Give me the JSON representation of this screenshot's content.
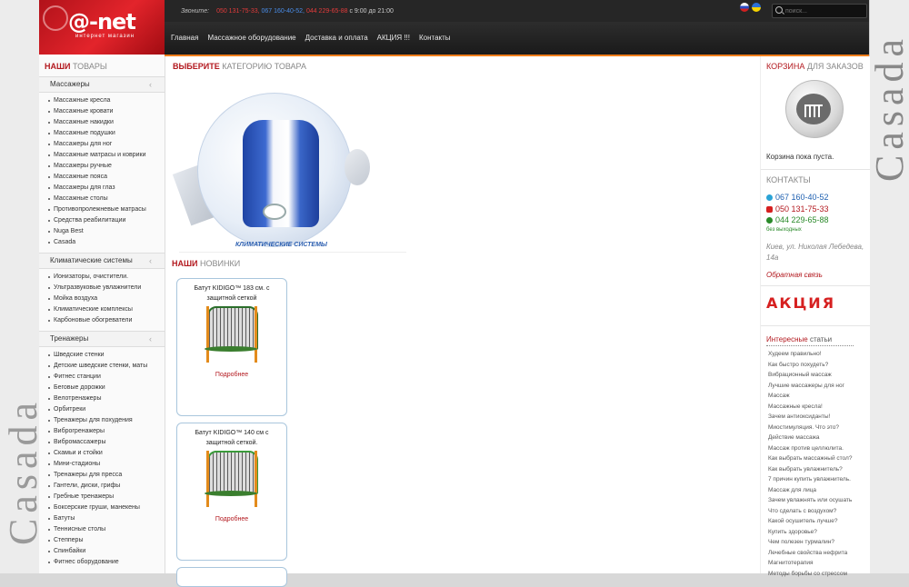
{
  "background": {
    "left_word": "Casada",
    "right_word": "Casada"
  },
  "header": {
    "logo": "@-net",
    "logo_sub": "интернет магазин",
    "call_label": "Звоните:",
    "phone1": "050 131-75-33,",
    "phone2": "067 160-40-52,",
    "phone3": "044 229-65-88",
    "hours": "с 9:00 до 21:00",
    "search_placeholder": "поиск...",
    "nav": [
      "Главная",
      "Массажное оборудование",
      "Доставка и оплата",
      "АКЦИЯ !!!",
      "Контакты"
    ]
  },
  "left": {
    "title_hi": "НАШИ",
    "title_lo": " ТОВАРЫ",
    "categories": [
      {
        "name": "Массажеры",
        "items": [
          "Массажные кресла",
          "Массажные кровати",
          "Массажные накидки",
          "Массажные подушки",
          "Массажеры для ног",
          "Массажные матрасы и коврики",
          "Массажеры ручные",
          "Массажные пояса",
          "Массажеры для глаз",
          "Массажные столы",
          "Противопролежневые матрасы",
          "Средства реабилитации",
          "Nuga Best",
          "Casada"
        ]
      },
      {
        "name": "Климатические системы",
        "items": [
          "Ионизаторы, очистители.",
          "Ультразвуковые увлажнители",
          "Мойка воздуха",
          "Климатические комплексы",
          "Карбоновые обогреватели"
        ]
      },
      {
        "name": "Тренажеры",
        "items": [
          "Шведские стенки",
          "Детские шведские стенки, маты",
          "Фитнес станции",
          "Беговые дорожки",
          "Велотренажеры",
          "Орбитреки",
          "Тренажеры для похудения",
          "Виброгренажеры",
          "Вибромассажеры",
          "Скамьи и стойки",
          "Мини-стадионы",
          "Тренажеры для пресса",
          "Гантели, диски, грифы",
          "Гребные тренажеры",
          "Боксерские груши, манекены",
          "Батуты",
          "Теннисные столы",
          "Степперы",
          "Спинбайки",
          "Фитнес оборудование"
        ]
      }
    ]
  },
  "center": {
    "title_hi": "ВЫБЕРИТЕ",
    "title_lo": " КАТЕГОРИЮ ТОВАРА",
    "banner_caption": "КЛИМАТИЧЕСКИЕ СИСТЕМЫ",
    "new_hi": "НАШИ",
    "new_lo": " НОВИНКИ",
    "products": [
      {
        "title": "Батут KIDIGO™ 183 см. с защитной сеткой",
        "more": "Подробнее"
      },
      {
        "title": "Батут KIDIGO™ 140 см с защитной сеткой.",
        "more": "Подробнее"
      }
    ]
  },
  "right": {
    "cart_hi": "КОРЗИНА",
    "cart_lo": " ДЛЯ ЗАКАЗОВ",
    "cart_empty": "Корзина пока пуста.",
    "contacts_title": "КОНТАКТЫ",
    "phone_kyivstar": "067 160-40-52",
    "phone_mts": "050 131-75-33",
    "phone_city": "044 229-65-88",
    "no_days_off": "без выходных",
    "address": "Киев, ул. Николая Лебедева, 14а",
    "feedback": "Обратная связь",
    "promo": "АКЦИЯ",
    "articles_title_a": "Интересные",
    "articles_title_b": " статьи",
    "articles": [
      "Худеем правильно!",
      "Как быстро похудеть?",
      "Вибрационный массаж",
      "Лучшие массажеры для ног",
      "Массаж",
      "Массажные кресла!",
      "Зачем антиоксиданты!",
      "Миостимуляция. Что это?",
      "Действие массажа",
      "Массаж против целлюлита.",
      "Как выбрать массажный стол?",
      "Как выбрать увлажнитель?",
      "7 причин купить увлажнитель.",
      "Массаж для лица",
      "Зачем увлажнять или осушать",
      "Что сделать с воздухом?",
      "Какой осушитель лучше?",
      "Купить здоровье?",
      "Чем полезен турмалин?",
      "Лечебные свойства нефрита",
      "Магнитотерапия",
      "Методы борьбы со стрессом"
    ]
  }
}
